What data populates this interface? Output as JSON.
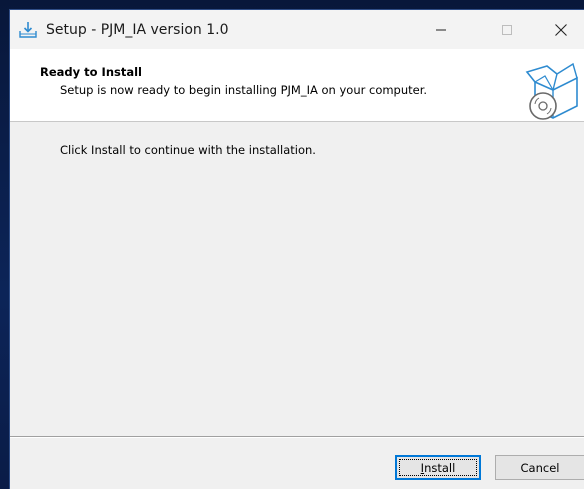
{
  "window": {
    "title": "Setup - PJM_IA version 1.0",
    "controls": {
      "minimize_icon": "minimize-icon",
      "maximize_icon": "maximize-icon",
      "close_icon": "close-icon"
    }
  },
  "header": {
    "title": "Ready to Install",
    "subtitle": "Setup is now ready to begin installing PJM_IA on your computer.",
    "icon": "installer-box-icon"
  },
  "content": {
    "instruction": "Click Install to continue with the installation."
  },
  "buttons": {
    "install_accel": "I",
    "install_rest": "nstall",
    "cancel": "Cancel"
  },
  "colors": {
    "accent": "#0078d7",
    "icon_blue": "#2e8bd0"
  }
}
